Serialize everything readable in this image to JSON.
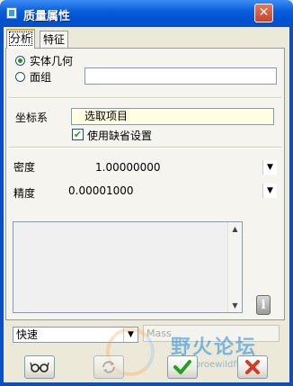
{
  "window": {
    "title": "质量属性",
    "close_glyph": "✕"
  },
  "tabs": [
    {
      "label": "分析",
      "active": true
    },
    {
      "label": "特征",
      "active": false
    }
  ],
  "geometry_type": {
    "options": [
      {
        "label": "实体几何",
        "selected": true
      },
      {
        "label": "面组",
        "selected": false
      }
    ],
    "quilt_value": ""
  },
  "coordinate_system": {
    "label": "坐标系",
    "field_value": "选取项目",
    "use_default": {
      "label": "使用缺省设置",
      "checked": true
    }
  },
  "density": {
    "label": "密度",
    "value": "1.00000000"
  },
  "accuracy": {
    "label": "精度",
    "value": "0.00001000"
  },
  "results_list": {
    "items": []
  },
  "mode": {
    "value": "快速"
  },
  "mass_button": {
    "label": "Mass"
  },
  "buttons": {
    "preview": "glasses-icon",
    "repeat": "refresh-icon",
    "ok": "checkmark-icon",
    "cancel": "cross-icon"
  },
  "watermark": {
    "title": "野火论坛",
    "url": "www.proewildfire.cn"
  },
  "colors": {
    "title_bar": "#0052d6",
    "dialog_bg": "#ece9d8",
    "selection_field": "#ffffe1",
    "tab_highlight": "#f5a623",
    "ok_green": "#21a121",
    "cancel_red": "#d23a2a"
  }
}
